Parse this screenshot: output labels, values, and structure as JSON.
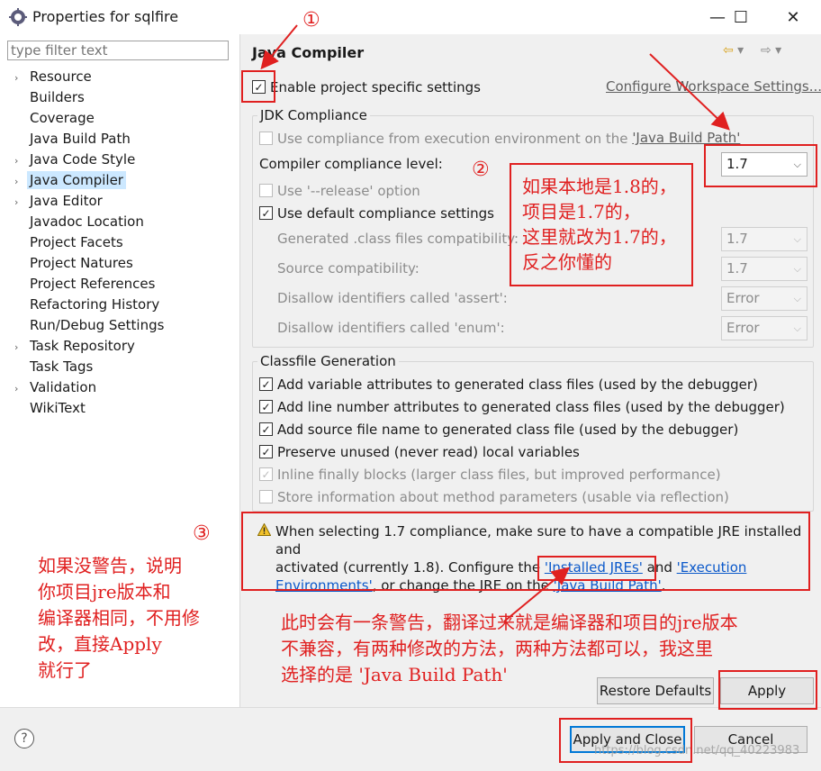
{
  "window": {
    "title": "Properties for sqlfire",
    "minimize": "—",
    "maximize": "☐",
    "close": "✕"
  },
  "sidebar": {
    "filter_placeholder": "type filter text",
    "items": [
      {
        "label": "Resource",
        "expandable": true
      },
      {
        "label": "Builders",
        "expandable": false
      },
      {
        "label": "Coverage",
        "expandable": false
      },
      {
        "label": "Java Build Path",
        "expandable": false
      },
      {
        "label": "Java Code Style",
        "expandable": true
      },
      {
        "label": "Java Compiler",
        "expandable": true,
        "selected": true
      },
      {
        "label": "Java Editor",
        "expandable": true
      },
      {
        "label": "Javadoc Location",
        "expandable": false
      },
      {
        "label": "Project Facets",
        "expandable": false
      },
      {
        "label": "Project Natures",
        "expandable": false
      },
      {
        "label": "Project References",
        "expandable": false
      },
      {
        "label": "Refactoring History",
        "expandable": false
      },
      {
        "label": "Run/Debug Settings",
        "expandable": false
      },
      {
        "label": "Task Repository",
        "expandable": true
      },
      {
        "label": "Task Tags",
        "expandable": false
      },
      {
        "label": "Validation",
        "expandable": true
      },
      {
        "label": "WikiText",
        "expandable": false
      }
    ]
  },
  "main": {
    "heading": "Java Compiler",
    "enable_specific": "Enable project specific settings",
    "configure_link": "Configure Workspace Settings...",
    "jdk_group": "JDK Compliance",
    "use_exec_env_prefix": "Use compliance from execution environment on the ",
    "use_exec_env_link": "'Java Build Path'",
    "compliance_label": "Compiler compliance level:",
    "compliance_value": "1.7",
    "use_release": "Use '--release' option",
    "use_default": "Use default compliance settings",
    "generated_label": "Generated .class files compatibility:",
    "generated_value": "1.7",
    "source_label": "Source compatibility:",
    "source_value": "1.7",
    "assert_label": "Disallow identifiers called 'assert':",
    "assert_value": "Error",
    "enum_label": "Disallow identifiers called 'enum':",
    "enum_value": "Error",
    "classfile_group": "Classfile Generation",
    "opt1": "Add variable attributes to generated class files (used by the debugger)",
    "opt2": "Add line number attributes to generated class files (used by the debugger)",
    "opt3": "Add source file name to generated class file (used by the debugger)",
    "opt4": "Preserve unused (never read) local variables",
    "opt5": "Inline finally blocks (larger class files, but improved performance)",
    "opt6": "Store information about method parameters (usable via reflection)",
    "warning_line1": "When selecting 1.7 compliance, make sure to have a compatible JRE installed and",
    "warning_line2_pre": "activated (currently 1.8). Configure the ",
    "warning_link_installed": "'Installed JREs'",
    "warning_and": " and ",
    "warning_link_exec": "'Execution",
    "warning_link_exec2": "Environments'",
    "warning_line3_mid": ", or change the JRE on the ",
    "warning_link_build": "'Java Build Path'",
    "warning_end": "."
  },
  "buttons": {
    "restore_defaults": "Restore Defaults",
    "apply": "Apply",
    "apply_close": "Apply and Close",
    "cancel": "Cancel",
    "help": "?"
  },
  "annotations": {
    "num1": "①",
    "num2": "②",
    "num3": "③",
    "note2": [
      "如果本地是1.8的，",
      "项目是1.7的，",
      "这里就改为1.7的，",
      "反之你懂的"
    ],
    "note3": [
      "如果没警告，说明",
      "你项目jre版本和",
      "编译器相同，不用修",
      "改，直接Apply",
      "就行了"
    ],
    "note4": [
      "此时会有一条警告，翻译过来就是编译器和项目的jre版本",
      "不兼容，有两种修改的方法，两种方法都可以，我这里",
      "选择的是 'Java Build Path'"
    ],
    "watermark": "https://blog.csdn.net/qq_40223983"
  },
  "colors": {
    "annotation_red": "#e02020",
    "link_blue": "#0a58ca",
    "selection": "#cce8ff"
  }
}
